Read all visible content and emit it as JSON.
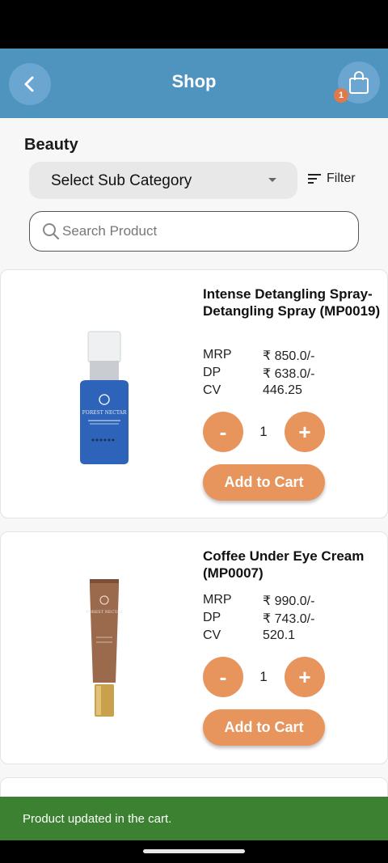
{
  "header": {
    "title": "Shop",
    "cart_count": "1"
  },
  "category": {
    "name": "Beauty",
    "sub_category_placeholder": "Select Sub Category",
    "filter_label": "Filter"
  },
  "search": {
    "placeholder": "Search Product"
  },
  "products": [
    {
      "name": "Intense Detangling Spray-Detangling Spray (MP0019)",
      "mrp_label": "MRP",
      "mrp": "₹ 850.0/-",
      "dp_label": "DP",
      "dp": "₹ 638.0/-",
      "cv_label": "CV",
      "cv": "446.25",
      "minus": "-",
      "quantity": "1",
      "plus": "+",
      "add_label": "Add to Cart",
      "image_icon": "serum-bottle-icon",
      "brand": "FOREST NECTAR"
    },
    {
      "name": "Coffee Under Eye Cream (MP0007)",
      "mrp_label": "MRP",
      "mrp": "₹ 990.0/-",
      "dp_label": "DP",
      "dp": "₹ 743.0/-",
      "cv_label": "CV",
      "cv": "520.1",
      "minus": "-",
      "quantity": "1",
      "plus": "+",
      "add_label": "Add to Cart",
      "image_icon": "cream-tube-icon",
      "brand": "FOREST NECTAR"
    }
  ],
  "snackbar": {
    "message": "Product updated in the cart."
  },
  "colors": {
    "header": "#4f93bf",
    "accent": "#e8955d",
    "snackbar": "#3b8131",
    "badge": "#e07a4a"
  }
}
